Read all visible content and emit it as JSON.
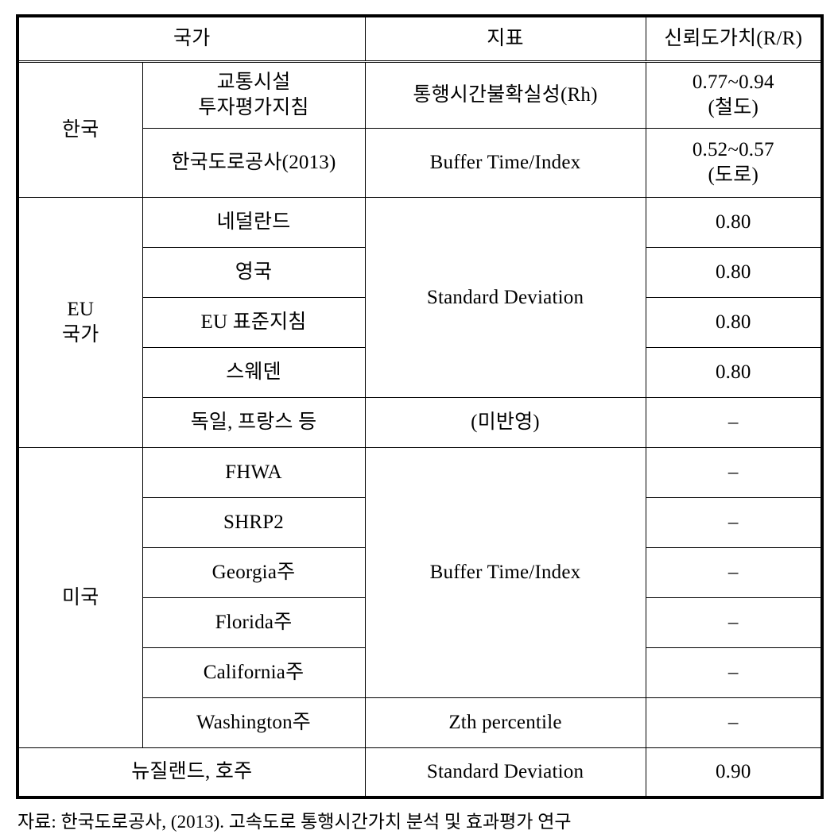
{
  "table": {
    "headers": {
      "country": "국가",
      "indicator": "지표",
      "value": "신뢰도가치(R/R)"
    },
    "groups": [
      {
        "name": "한국",
        "rows": [
          {
            "sub_name_line1": "교통시설",
            "sub_name_line2": "투자평가지침",
            "indicator": "통행시간불확실성(Rh)",
            "value_line1": "0.77~0.94",
            "value_line2": "(철도)"
          },
          {
            "sub_name_line1": "한국도로공사(2013)",
            "sub_name_line2": "",
            "indicator": "Buffer Time/Index",
            "value_line1": "0.52~0.57",
            "value_line2": "(도로)"
          }
        ]
      },
      {
        "name_line1": "EU",
        "name_line2": "국가",
        "rows": [
          {
            "sub_name": "네덜란드",
            "value": "0.80"
          },
          {
            "sub_name": "영국",
            "value": "0.80"
          },
          {
            "sub_name": "EU 표준지침",
            "value": "0.80"
          },
          {
            "sub_name": "스웨덴",
            "value": "0.80"
          },
          {
            "sub_name": "독일, 프랑스 등",
            "indicator": "(미반영)",
            "value": "–"
          }
        ],
        "merged_indicator": "Standard Deviation"
      },
      {
        "name": "미국",
        "rows": [
          {
            "sub_name": "FHWA",
            "value": "–"
          },
          {
            "sub_name": "SHRP2",
            "value": "–"
          },
          {
            "sub_name": "Georgia주",
            "value": "–"
          },
          {
            "sub_name": "Florida주",
            "value": "–"
          },
          {
            "sub_name": "California주",
            "value": "–"
          },
          {
            "sub_name": "Washington주",
            "indicator": "Zth percentile",
            "value": "–"
          }
        ],
        "merged_indicator": "Buffer Time/Index"
      }
    ],
    "final_row": {
      "country": "뉴질랜드, 호주",
      "indicator": "Standard Deviation",
      "value": "0.90"
    }
  },
  "source_note": "자료: 한국도로공사, (2013). 고속도로 통행시간가치 분석 및 효과평가 연구"
}
